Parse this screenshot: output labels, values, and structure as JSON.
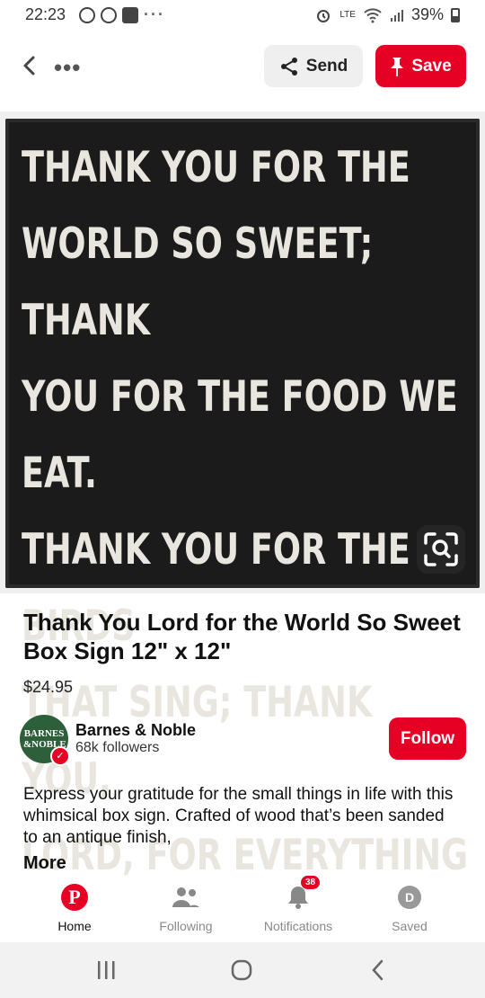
{
  "status_bar": {
    "time": "22:23",
    "overflow": "···",
    "network": "LTE",
    "battery": "39%"
  },
  "header": {
    "more": "•••",
    "send_label": "Send",
    "save_label": "Save"
  },
  "pin_image": {
    "sign_lines": [
      "THANK YOU FOR THE",
      "WORLD SO SWEET; THANK",
      "YOU FOR THE FOOD WE EAT.",
      "THANK YOU FOR THE BIRDS",
      "THAT SING; THANK YOU,",
      "LORD, FOR EVERYTHING"
    ]
  },
  "details": {
    "title": "Thank You Lord for the World So Sweet Box Sign 12\" x 12\"",
    "price": "$24.95",
    "brand_logo_text": "BARNES &NOBLE",
    "brand_name": "Barnes & Noble",
    "followers": "68k followers",
    "follow_label": "Follow",
    "description": "Express your gratitude for the small things in life with this whimsical box sign. Crafted of wood that’s been sanded to an antique finish,",
    "more_label": "More"
  },
  "bottom_nav": {
    "items": [
      {
        "label": "Home"
      },
      {
        "label": "Following"
      },
      {
        "label": "Notifications",
        "badge": "38"
      },
      {
        "label": "Saved",
        "avatar_letter": "D"
      }
    ]
  },
  "colors": {
    "brand_red": "#e60023",
    "barnes_green": "#2d5f3a"
  }
}
